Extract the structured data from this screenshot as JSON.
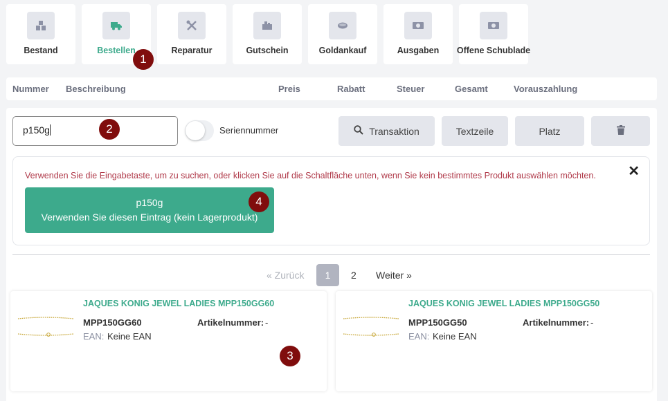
{
  "tabs": [
    {
      "label": "Bestand",
      "icon": "inventory-icon",
      "active": false
    },
    {
      "label": "Bestellen",
      "icon": "truck-icon",
      "active": true
    },
    {
      "label": "Reparatur",
      "icon": "tools-icon",
      "active": false
    },
    {
      "label": "Gutschein",
      "icon": "voucher-icon",
      "active": false
    },
    {
      "label": "Goldankauf",
      "icon": "gold-icon",
      "active": false
    },
    {
      "label": "Ausgaben",
      "icon": "money-icon",
      "active": false
    },
    {
      "label": "Offene Schublade",
      "icon": "drawer-icon",
      "active": false
    }
  ],
  "columns": [
    "Nummer",
    "Beschreibung",
    "Preis",
    "Rabatt",
    "Steuer",
    "Gesamt",
    "Vorauszahlung"
  ],
  "search": {
    "value": "p150g"
  },
  "serial_toggle_label": "Seriennummer",
  "buttons": {
    "transaktion": "Transaktion",
    "textzeile": "Textzeile",
    "platz": "Platz",
    "delete_icon": "trash-icon"
  },
  "alert": {
    "message": "Verwenden Sie die Eingabetaste, um zu suchen, oder klicken Sie auf die Schaltfläche unten, wenn Sie kein bestimmtes Produkt auswählen möchten.",
    "close": "✕",
    "use_entry_value": "p150g",
    "use_entry_label": "Verwenden Sie diesen Eintrag (kein Lagerprodukt)"
  },
  "pagination": {
    "prev": "« Zurück",
    "pages": [
      "1",
      "2"
    ],
    "current": "1",
    "next": "Weiter »"
  },
  "products": [
    {
      "title": "JAQUES KONIG JEWEL LADIES MPP150GG60",
      "sku": "MPP150GG60",
      "article_label": "Artikelnummer:",
      "article_value": "-",
      "ean_label": "EAN:",
      "ean_value": "Keine EAN"
    },
    {
      "title": "JAQUES KONIG JEWEL LADIES MPP150GG50",
      "sku": "MPP150GG50",
      "article_label": "Artikelnummer:",
      "article_value": "-",
      "ean_label": "EAN:",
      "ean_value": "Keine EAN"
    }
  ],
  "annotations": [
    "1",
    "2",
    "3",
    "4"
  ],
  "colors": {
    "accent": "#3daa8c",
    "badge": "#800d0d",
    "alert_text": "#b03a4a",
    "button_bg": "#e4e6ec"
  }
}
